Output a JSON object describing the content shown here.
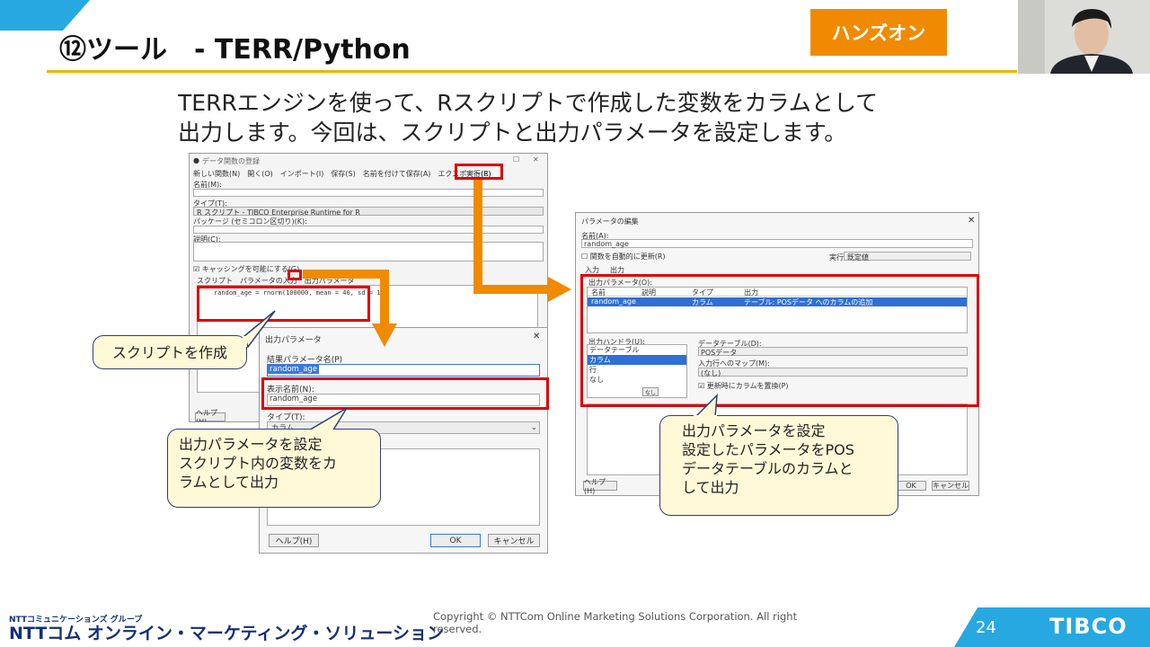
{
  "header": {
    "title": "⑫ツール　- TERR/Python",
    "badge": "ハンズオン"
  },
  "lead": {
    "line1": "TERRエンジンを使って、Rスクリプトで作成した変数をカラムとして",
    "line2": "出力します。今回は、スクリプトと出力パラメータを設定します。"
  },
  "left_dialog": {
    "title": "データ関数の登録",
    "toolbar": [
      "新しい関数(N)",
      "開く(O)",
      "インポート(I)",
      "保存(S)",
      "名前を付けて保存(A)",
      "エクスポート(E)",
      "実行(R)"
    ],
    "name_label": "名前(M):",
    "type_label": "タイプ(T):",
    "type_value": "R スクリプト - TIBCO Enterprise Runtime for R",
    "packages_label": "パッケージ (セミコロン区切り)(K):",
    "desc_label": "説明(C):",
    "caching_label": "キャッシングを可能にする(G)",
    "tabs": [
      "スクリプト",
      "パラメータの入力",
      "出力パラメータ"
    ],
    "script": "random_age = rnorm(100000, mean = 40, sd = 10)",
    "help": "ヘルプ(H)"
  },
  "output_dialog": {
    "title": "出力パラメータ",
    "result_label": "結果パラメータ名(P)",
    "result_value": "random_age",
    "display_label": "表示名前(N):",
    "display_value": "random_age",
    "type_label": "タイプ(T):",
    "type_value": "カラム",
    "help": "ヘルプ(H)",
    "ok": "OK",
    "cancel": "キャンセル"
  },
  "right_dialog": {
    "title": "パラメータの編集",
    "name_label": "名前(A):",
    "name_value": "random_age",
    "auto_update": "関数を自動的に更新(R)",
    "exec_label": "実行場所:",
    "exec_value": "既定値",
    "tabs": [
      "入力",
      "出力"
    ],
    "params_label": "出力パラメータ(O):",
    "columns": [
      "名前",
      "説明",
      "タイプ",
      "出力"
    ],
    "row": [
      "random_age",
      "",
      "カラム",
      "テーブル: POSデータ へのカラムの追加"
    ],
    "handler_label": "出力ハンドラ(U):",
    "handlers": [
      "データテーブル",
      "カラム",
      "行",
      "なし"
    ],
    "datatable_label": "データテーブル(D):",
    "datatable_value": "POSデータ",
    "map_label": "入力行へのマップ(M):",
    "map_value": "(なし)",
    "replace_label": "更新時にカラムを置換(P)",
    "small_btn": "なし",
    "help": "ヘルプ(H)",
    "ok": "OK",
    "cancel": "キャンセル"
  },
  "callouts": {
    "script": "スクリプトを作成",
    "left_line1": "出力パラメータを設定",
    "left_line2": "スクリプト内の変数をカ",
    "left_line3": "ラムとして出力",
    "right_line1": "出力パラメータを設定",
    "right_line2": "設定したパラメータをPOS",
    "right_line3": "データテーブルのカラムと",
    "right_line4": "して出力"
  },
  "footer": {
    "company_small": "NTTコミュニケーションズ グループ",
    "company": "NTTコム オンライン・マーケティング・ソリューション",
    "copyright": "Copyright © NTTCom Online Marketing Solutions Corporation. All right reserved.",
    "page": "24",
    "brand": "TIBCO"
  },
  "colors": {
    "accent_blue": "#27a8e0",
    "accent_orange": "#f08a00",
    "highlight_red": "#e00000",
    "callout_fill": "#fff9d8"
  }
}
